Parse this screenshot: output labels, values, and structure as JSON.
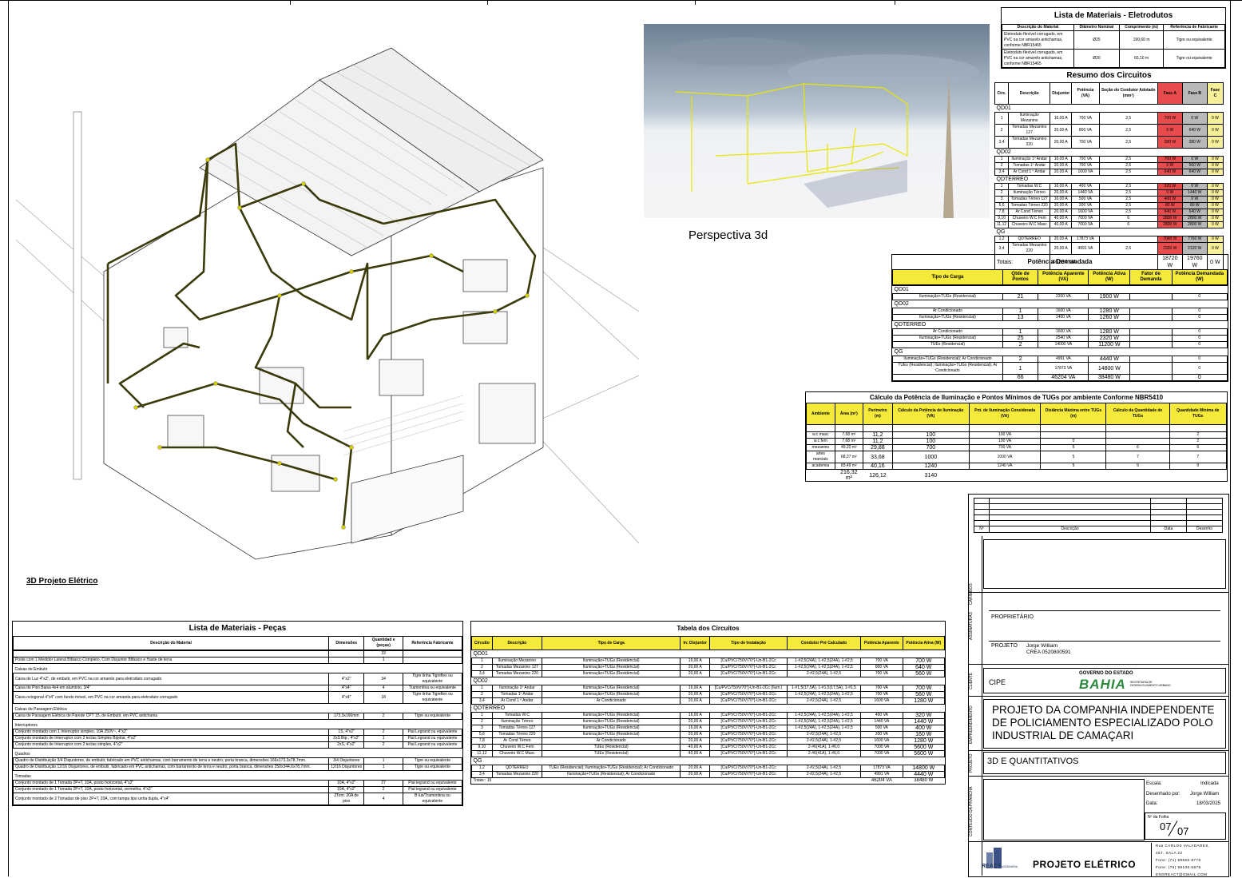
{
  "drawing_3d": {
    "caption": "3D Projeto Elétrico"
  },
  "perspective": {
    "caption": "Perspectiva 3d"
  },
  "eletrodutos": {
    "title": "Lista de Materiais - Eletrodutos",
    "headers": [
      "Descrição do Material",
      "Diâmetro Nominal",
      "Comprimento (m)",
      "Referência de Fabricante"
    ],
    "rows": [
      [
        "Eletroduto flexível corrugado, em PVC na cor amarelo antichamas, conforme NBR15465",
        "Ø25",
        "190,60 m",
        "Tigre ou equivalente"
      ],
      [
        "Eletroduto flexível corrugado, em PVC na cor amarelo antichamas, conforme NBR15465",
        "Ø20",
        "60,10 m",
        "Tigre ou equivalente"
      ]
    ]
  },
  "resumo": {
    "title": "Resumo dos Circuitos",
    "headers": [
      "Circ.",
      "Descrição",
      "Disjuntor",
      "Potência (VA)",
      "Seção do Condutor Adotado (mm²)",
      "Fase A",
      "Fase B",
      "Fase C"
    ],
    "groups": [
      {
        "name": "QD01",
        "rows": [
          [
            "1",
            "Iluminação Mezanino",
            "16,00 A",
            "700 VA",
            "2,5",
            "700 W",
            "0 W",
            "0 W"
          ],
          [
            "2",
            "Tomadas Mezanino 127",
            "20,00 A",
            "800 VA",
            "2,5",
            "0 W",
            "640 W",
            "0 W"
          ],
          [
            "3,4",
            "Tomadas Mezanino 220",
            "20,00 A",
            "700 VA",
            "2,5",
            "280 W",
            "280 W",
            "0 W"
          ]
        ]
      },
      {
        "name": "QD02",
        "rows": [
          [
            "1",
            "Iluminação 1º Andar",
            "16,00 A",
            "700 VA",
            "2,5",
            "700 W",
            "0 W",
            "0 W"
          ],
          [
            "2",
            "Tomadas 1º Andar",
            "20,00 A",
            "700 VA",
            "2,5",
            "0 W",
            "560 W",
            "0 W"
          ],
          [
            "3,4",
            "Ar Cond 1 º Andar",
            "20,00 A",
            "1600 VA",
            "2,5",
            "640 W",
            "640 W",
            "0 W"
          ]
        ]
      },
      {
        "name": "QDTERREO",
        "rows": [
          [
            "1",
            "Tomadas W.C",
            "16,00 A",
            "400 VA",
            "2,5",
            "320 W",
            "0 W",
            "0 W"
          ],
          [
            "2",
            "Iluminação Térreo",
            "20,00 A",
            "1440 VA",
            "2,5",
            "0 W",
            "1440 W",
            "0 W"
          ],
          [
            "3",
            "Tomadas Térreo 127",
            "16,00 A",
            "500 VA",
            "2,5",
            "400 W",
            "0 W",
            "0 W"
          ],
          [
            "5,6",
            "Tomadas Térreo 220",
            "20,00 A",
            "200 VA",
            "2,5",
            "80 W",
            "80 W",
            "0 W"
          ],
          [
            "7,8",
            "Ar Cond Térreo",
            "20,00 A",
            "1600 VA",
            "2,5",
            "640 W",
            "640 W",
            "0 W"
          ],
          [
            "9,10",
            "Chuveiro W.C Fem",
            "40,00 A",
            "7000 VA",
            "6",
            "2800 W",
            "2800 W",
            "0 W"
          ],
          [
            "11,12",
            "Chuveiro W.C Masc",
            "40,00 A",
            "7000 VA",
            "6",
            "2800 W",
            "2800 W",
            "0 W"
          ]
        ]
      },
      {
        "name": "QG",
        "rows": [
          [
            "1,2",
            "QDTERREO",
            "20,00 A",
            "17873 VA",
            "",
            "7040 W",
            "7760 W",
            "0 W"
          ],
          [
            "3,4",
            "Tomadas Mezanino 220",
            "20,00 A",
            "4991 VA",
            "2,5",
            "2320 W",
            "2120 W",
            "0 W"
          ]
        ]
      }
    ],
    "totals": [
      "Totais:",
      "46204 VA",
      "18720 W",
      "19760 W",
      "0 W"
    ]
  },
  "demanda": {
    "title": "Potência Demandada",
    "headers": [
      "Tipo de Carga",
      "Qtde de Pontos",
      "Potência Aparente (VA)",
      "Potência Ativa (W)",
      "Fator de Demanda",
      "Potência Demandada (W)"
    ],
    "groups": [
      {
        "name": "QD01",
        "rows": [
          [
            "Iluminação+TUGs (Residencial)",
            "21",
            "2200 VA",
            "1900 W",
            "",
            "0"
          ]
        ]
      },
      {
        "name": "QD02",
        "rows": [
          [
            "Ar Condicionado",
            "1",
            "1600 VA",
            "1280 W",
            "",
            "0"
          ],
          [
            "Iluminação+TUGs (Residencial)",
            "13",
            "1400 VA",
            "1260 W",
            "",
            "0"
          ]
        ]
      },
      {
        "name": "QDTERREO",
        "rows": [
          [
            "Ar Condicionado",
            "1",
            "1600 VA",
            "1280 W",
            "",
            "0"
          ],
          [
            "Iluminação+TUGs (Residencial)",
            "25",
            "2540 VA",
            "2320 W",
            "",
            "0"
          ],
          [
            "TUEs (Residencial)",
            "2",
            "14000 VA",
            "11200 W",
            "",
            "0"
          ]
        ]
      },
      {
        "name": "QG",
        "rows": [
          [
            "Iluminação+TUGs (Residencial); Ar Condicionado",
            "2",
            "4991 VA",
            "4440 W",
            "",
            "0"
          ],
          [
            "TUEs (Residencial); Iluminação+TUGs (Residencial); Ar Condicionado",
            "1",
            "17873 VA",
            "14800 W",
            "",
            "0"
          ]
        ]
      }
    ],
    "totals": [
      "",
      "66",
      "46204 VA",
      "38480 W",
      "",
      "0"
    ]
  },
  "calculo": {
    "title": "Cálculo da Potência de Iluminação e Pontos Mínimos de TUGs por ambiente Conforme NBR5410",
    "headers": [
      "Ambiente",
      "Área (m²)",
      "Perímetro (m)",
      "Cálculo da Potência de Iluminação (VA)",
      "Pot. de Iluminação Considerada (VA)",
      "Distância Máxima entre TUGs (m)",
      "Cálculo da Quantidade de TUGs",
      "Quantidade Mínima de TUGs"
    ],
    "rows": [
      [
        "w.c masc",
        "7,68 m²",
        "11,2",
        "100",
        "100 VA",
        "",
        "",
        "2"
      ],
      [
        "w.c fem",
        "7,68 m²",
        "11,2",
        "100",
        "100 VA",
        "0",
        "",
        "2"
      ],
      [
        "mezanino",
        "49,20 m²",
        "29,88",
        "700",
        "700 VA",
        "5",
        "6",
        "6"
      ],
      [
        "artes marciais",
        "68,27 m²",
        "33,68",
        "1000",
        "1000 VA",
        "5",
        "7",
        "7"
      ],
      [
        "academia",
        "83,49 m²",
        "40,16",
        "1240",
        "1240 VA",
        "5",
        "9",
        "9"
      ]
    ],
    "totals": [
      "",
      "216,32 m²",
      "126,12",
      "3140",
      "",
      "",
      "",
      ""
    ]
  },
  "pecas": {
    "title": "Lista de Materiais - Peças",
    "headers": [
      "Descrição do Material",
      "Dimensões",
      "Quantidad e (peças)",
      "Referência Fabricante"
    ],
    "total_qty": "33",
    "rows": [
      {
        "type": "item",
        "cells": [
          "Poste com 1 Medidor Lateral Bifásico Completo, Com Disjuntor Bifásico e Haste de terra",
          "",
          "1",
          ""
        ]
      },
      {
        "type": "section",
        "label": "Caixas de Embutir"
      },
      {
        "type": "item",
        "cells": [
          "Caixa de Luz 4\"x2\", de embutir, em PVC na cor amarelo para eletroduto corrugado",
          "4\"x2\"",
          "34",
          "Tigre linha Tigreflex ou equivalente"
        ]
      },
      {
        "type": "item",
        "cells": [
          "Caixa de Piso Baixa 4x4 em alumínio, 3/4\"",
          "4\"x4\"",
          "4",
          "Tramontina ou equivalente"
        ]
      },
      {
        "type": "item",
        "cells": [
          "Caixa octogonal 4\"x4\" com fundo móvel, em PVC na cor amarela para eletroduto corrugado",
          "4\"x4\"",
          "18",
          "Tigre linha Tigreflex ou equivalente"
        ]
      },
      {
        "type": "section",
        "label": "Caixas de Passagem Elétrica"
      },
      {
        "type": "item",
        "cells": [
          "Caixa de Passagem Elétrica de Parede CPT 15, de Embutir, em PVC antichama",
          "173,3x166mm",
          "2",
          "Tigre ou equivalente"
        ]
      },
      {
        "type": "section",
        "label": "Interruptores"
      },
      {
        "type": "item",
        "cells": [
          "Conjunto montado com 1 Interruptor simples, 10A 250V~, 4\"x2\"",
          "1S, 4\"x2\"",
          "2",
          "Pial Legrand ou equivalente"
        ]
      },
      {
        "type": "item",
        "cells": [
          "Conjunto montado de Interruptor com 2 teclas Simples Bipolar, 4\"x2\"",
          "2xS Bip., 4\"x2\"",
          "1",
          "Pial Legrand ou equivalente"
        ]
      },
      {
        "type": "item",
        "cells": [
          "Conjunto montado de Interruptor com 2 teclas simples, 4\"x2\"",
          "2xS, 4\"x2\"",
          "2",
          "Pial Legrand ou equivalente"
        ]
      },
      {
        "type": "section",
        "label": "Quadros"
      },
      {
        "type": "item",
        "cells": [
          "Quadro de Distribuição 3/4 Disjuntores, de embutir, fabricado em PVC antichamas, com barramento de terra e neutro, porta branca, dimensões 166x173,3x78,7mm.",
          "3/4 Disjuntores",
          "1",
          "Tigre ou equivalente"
        ]
      },
      {
        "type": "item",
        "cells": [
          "Quadro de Distribuição 12/16 Disjuntores, de embutir, fabricado em PVC antichamas, com barramento de terra e neutro, porta branca, dimensões 250x344,6x78,7mm.",
          "12/16 Disjuntores",
          "1",
          "Tigre ou equivalente"
        ]
      },
      {
        "type": "section",
        "label": "Tomadas"
      },
      {
        "type": "item",
        "cells": [
          "Conjunto montado de 1 Tomada 2P+T, 10A, posto horizontal, 4\"x2\"",
          "10A, 4\"x2\"",
          "27",
          "Pial legrand ou equivalente"
        ]
      },
      {
        "type": "item",
        "cells": [
          "Conjunto montado de 1 Tomada 2P+T, 10A, posto horizontal, vermelha, 4\"x2\"",
          "10A, 4\"x2\"",
          "2",
          "Pial legrand ou equivalente"
        ]
      },
      {
        "type": "item",
        "cells": [
          "Conjunto montado de 2 Tomadas de piso 2P+T, 20A, com tampa tipo unha dupla, 4\"x4\"",
          "2Tom. 20A de piso",
          "4",
          "B lux/Tramontina ou equivalente"
        ]
      }
    ]
  },
  "circuitos": {
    "title": "Tabela dos Circuitos",
    "headers": [
      "Circuito",
      "Descrição",
      "Tipo de Carga",
      "In: Disjuntor",
      "Tipo de Instalação",
      "Condutor Pré Calculado",
      "Potência Aparente",
      "Potência Ativa (W)"
    ],
    "groups": [
      {
        "name": "QD01",
        "rows": [
          [
            "1",
            "Iluminação Mezanino",
            "Iluminação+TUGs (Residencial)",
            "16,00 A",
            "[Cu/PVC/750V/70°]-Un-B1-2Cc",
            "1-#2,5(24A), 1-#2,5(24A), 1-#2,5",
            "700 VA",
            "700 W"
          ],
          [
            "2",
            "Tomadas Mezanino 127",
            "Iluminação+TUGs (Residencial)",
            "20,00 A",
            "[Cu/PVC/750V/70°]-Un-B1-2Cc",
            "1-#2,5(24A), 1-#2,5(24A), 1-#2,5",
            "800 VA",
            "640 W"
          ],
          [
            "3,4",
            "Tomadas Mezanino 220",
            "Iluminação+TUGs (Residencial)",
            "20,00 A",
            "[Cu/PVC/750V/70°]-Un-B1-2Cc",
            "2-#2,5(24A), 1-#2,5",
            "700 VA",
            "560 W"
          ]
        ]
      },
      {
        "name": "QD02",
        "rows": [
          [
            "1",
            "Iluminação 1º Andar",
            "Iluminação+TUGs (Residencial)",
            "16,00 A",
            "[Cu/PVC/750V/70°]-Un-B1-2Cc (Ilum.)",
            "1-#1,5(17,5A), 1-#1,5(17,5A), 1-#1,5",
            "700 VA",
            "700 W"
          ],
          [
            "2",
            "Tomadas 1º Andar",
            "Iluminação+TUGs (Residencial)",
            "20,00 A",
            "[Cu/PVC/750V/70°]-Un-B1-2Cc",
            "1-#2,5(24A), 1-#2,5(24A), 1-#2,5",
            "700 VA",
            "560 W"
          ],
          [
            "3,4",
            "Ar Cond 1 º Andar",
            "Ar Condicionado",
            "20,00 A",
            "[Cu/PVC/750V/70°]-Un-B1-2Cc",
            "2-#2,5(24A), 1-#2,5",
            "1600 VA",
            "1280 W"
          ]
        ]
      },
      {
        "name": "QDTERREO",
        "rows": [
          [
            "1",
            "Tomadas W.C",
            "Iluminação+TUGs (Residencial)",
            "16,00 A",
            "[Cu/PVC/750V/70°]-Un-B1-2Cc",
            "1-#2,5(24A), 1-#2,5(24A), 1-#2,5",
            "400 VA",
            "320 W"
          ],
          [
            "2",
            "Iluminação Térreo",
            "Iluminação+TUGs (Residencial)",
            "20,00 A",
            "[Cu/PVC/750V/70°]-Un-B1-2Cc",
            "1-#2,5(24A), 1-#2,5(24A), 1-#2,5",
            "1440 VA",
            "1440 W"
          ],
          [
            "3",
            "Tomadas Térreo 127",
            "Iluminação+TUGs (Residencial)",
            "16,00 A",
            "[Cu/PVC/750V/70°]-Un-B1-2Cc",
            "1-#2,5(24A), 1-#2,5(24A), 1-#2,5",
            "500 VA",
            "400 W"
          ],
          [
            "5,6",
            "Tomadas Térreo 220",
            "Iluminação+TUGs (Residencial)",
            "20,00 A",
            "[Cu/PVC/750V/70°]-Un-B1-2Cc",
            "2-#2,5(24A), 1-#2,5",
            "200 VA",
            "160 W"
          ],
          [
            "7,8",
            "Ar Cond Térreo",
            "Ar Condicionado",
            "20,00 A",
            "[Cu/PVC/750V/70°]-Un-B1-2Cc",
            "2-#2,5(24A), 1-#2,5",
            "1600 VA",
            "1280 W"
          ],
          [
            "9,10",
            "Chuveiro W.C Fem",
            "TUEs (Residencial)",
            "40,00 A",
            "[Cu/PVC/750V/70°]-Un-B1-2Cc",
            "2-#6(41A), 1-#6,0",
            "7000 VA",
            "5600 W"
          ],
          [
            "11,12",
            "Chuveiro W.C Masc",
            "TUEs (Residencial)",
            "40,00 A",
            "[Cu/PVC/750V/70°]-Un-B1-2Cc",
            "2-#6(41A), 1-#6,0",
            "7000 VA",
            "5600 W"
          ]
        ]
      },
      {
        "name": "QG",
        "rows": [
          [
            "1,2",
            "QDTERREO",
            "TUEs (Residencial); Iluminação+TUGs (Residencial); Ar Condicionado",
            "20,00 A",
            "[Cu/PVC/750V/70°]-Un-B1-2Cc",
            "2-#2,5(24A), 1-#2,5",
            "17873 VA",
            "14800 W"
          ],
          [
            "3,4",
            "Tomadas Mezanino 220",
            "Iluminação+TUGs (Residencial); Ar Condicionado",
            "20,00 A",
            "[Cu/PVC/750V/70°]-Un-B1-2Cc",
            "2-#2,5(24A), 1-#2,5",
            "4991 VA",
            "4440 W"
          ]
        ]
      }
    ],
    "totals": [
      "Totais:: 15",
      "46204 VA",
      "38480 W"
    ]
  },
  "titleblock": {
    "revision_headers": [
      "Nº",
      "Descrição",
      "Data",
      "Desenho"
    ],
    "side_labels": {
      "carimbos": "CARIMBOS",
      "assinaturas": "ASSINATURAS",
      "cliente": "CLIENTE",
      "empreendimento": "EMPREENDIMENTO",
      "projeto": "PROJETO",
      "conteudo": "CONTEÚDO DA PRANCHA"
    },
    "proprietario": "PROPRIETÁRIO",
    "projeto_label": "PROJETO",
    "engineer_name": "Jorge William",
    "engineer_crea": "CREA  0520800591",
    "cliente": "CIPE",
    "gov_line1": "GOVERNO DO ESTADO",
    "gov_logo": "BAHIA",
    "gov_line2": "SECRETARIA DE DESENVOLVIMENTO URBANO",
    "empreendimento": "PROJETO DA COMPANHIA INDEPENDENTE DE POLICIAMENTO ESPECIALIZADO POLO INDUSTRIAL DE CAMAÇARI",
    "projeto": "3D E QUANTITATIVOS",
    "escala_label": "Escala:",
    "escala": "Indicada",
    "desenhado_label": "Desenhado por:",
    "desenhado": "Jorge William",
    "data_label": "Data:",
    "data": "18/03/2025",
    "folha_label": "Nº da Folha",
    "folha_num": "07",
    "folha_total": "07",
    "firm_logo": "REACT",
    "firm_sub": "ENGENHARIA",
    "firm_title": "PROJETO ELÉTRICO",
    "address": [
      "Rua CARLOS VALADARES,",
      "457, SALA 22",
      "Fone: (71) 99565-8778",
      "Fone: (75) 99105-5875",
      "ENGREACT@GMAIL.COM"
    ]
  },
  "colors": {
    "yellow_header": "#f5ea3a",
    "phase_red": "#e84b4b",
    "phase_gray": "#b8b8b8",
    "phase_yellow": "#f4ef98",
    "conduit": "#3a3a0a"
  }
}
